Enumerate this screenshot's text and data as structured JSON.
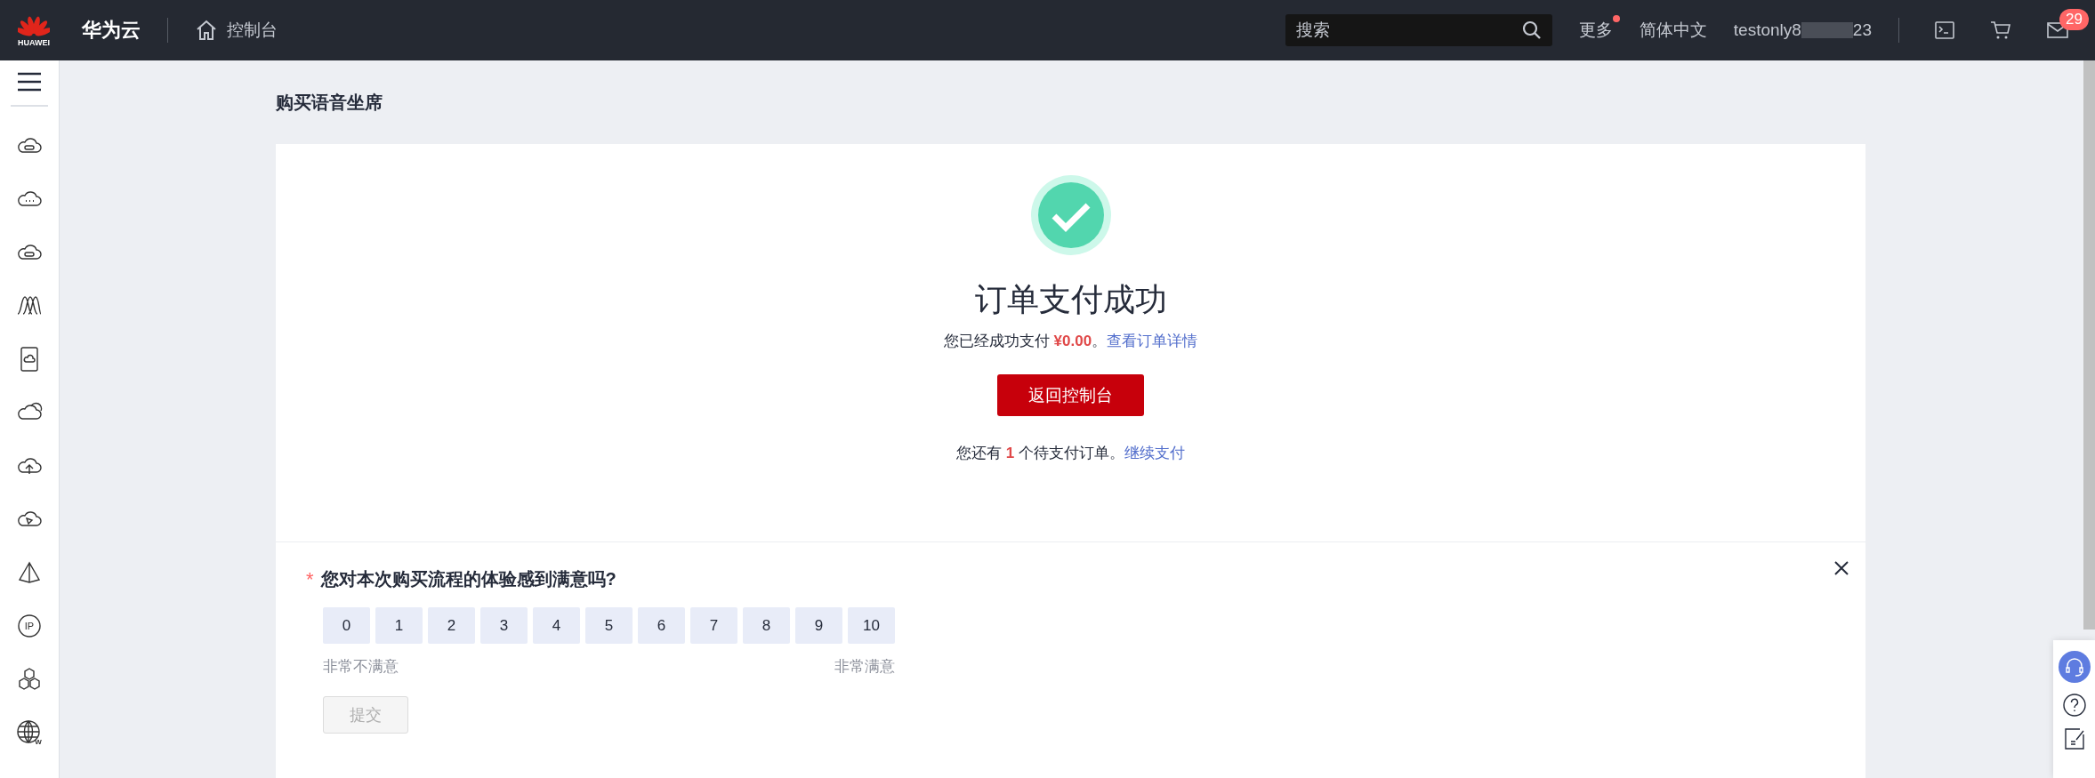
{
  "topbar": {
    "logo_text": "HUAWEI",
    "brand": "华为云",
    "console": "控制台",
    "search": {
      "placeholder": "搜索"
    },
    "more": {
      "label": "更多",
      "dot": true
    },
    "language": "简体中文",
    "user": {
      "prefix": "testonly8",
      "suffix": "23"
    },
    "mail_badge": "29"
  },
  "sidebar": {
    "items": [
      {
        "kind": "cloud-disk"
      },
      {
        "kind": "cloud-dots"
      },
      {
        "kind": "cloud-disk"
      },
      {
        "kind": "waves"
      },
      {
        "kind": "phone"
      },
      {
        "kind": "clouds"
      },
      {
        "kind": "cloud-upload"
      },
      {
        "kind": "cloud-send"
      },
      {
        "kind": "pyramid"
      },
      {
        "kind": "badge",
        "glyph": "IP"
      },
      {
        "kind": "hexagons"
      },
      {
        "kind": "globe",
        "glyph": "W"
      }
    ]
  },
  "page_title": "购买语音坐席",
  "result": {
    "title": "订单支付成功",
    "paid_text": "您已经成功支付",
    "amount": "¥0.00",
    "paid_end": "。",
    "detail_link": "查看订单详情",
    "button": "返回控制台",
    "pending_prefix": "您还有",
    "pending_count": "1",
    "pending_suffix": "个待支付订单。",
    "pending_link": "继续支付"
  },
  "survey": {
    "required_mark": "*",
    "question": "您对本次购买流程的体验感到满意吗?",
    "scores": [
      {
        "label": "0",
        "selected": false
      },
      {
        "label": "1",
        "selected": false
      },
      {
        "label": "2",
        "selected": false
      },
      {
        "label": "3",
        "selected": false
      },
      {
        "label": "4",
        "selected": false
      },
      {
        "label": "5",
        "selected": false
      },
      {
        "label": "6",
        "selected": false
      },
      {
        "label": "7",
        "selected": false
      },
      {
        "label": "8",
        "selected": false
      },
      {
        "label": "9",
        "selected": false
      },
      {
        "label": "10",
        "selected": false
      }
    ],
    "low_label": "非常不满意",
    "high_label": "非常满意",
    "submit": {
      "label": "提交",
      "disabled": true
    }
  }
}
